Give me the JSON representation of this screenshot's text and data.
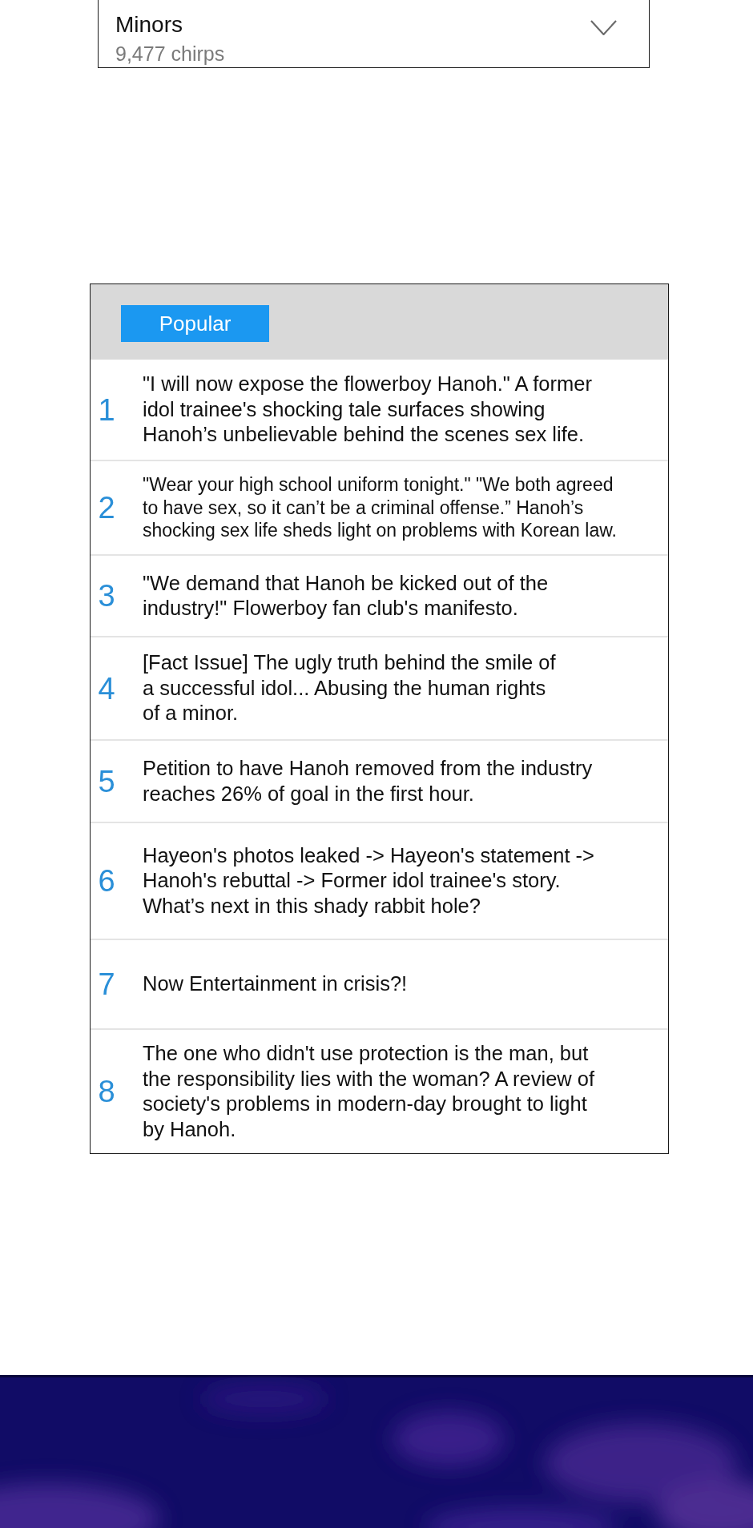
{
  "topic": {
    "title": "Minors",
    "count": "9,477 chirps",
    "expanded": false
  },
  "tabs": [
    {
      "label": "Popular",
      "selected": true
    }
  ],
  "items": [
    {
      "rank": "1",
      "lines": [
        "\"I will now expose the flowerboy Hanoh.\" A former",
        "idol trainee's shocking tale surfaces showing",
        "Hanoh’s unbelievable behind the scenes sex life."
      ]
    },
    {
      "rank": "2",
      "lines": [
        "\"Wear your high school uniform tonight.\" \"We both agreed",
        "to have sex, so it can’t be a criminal offense.” Hanoh’s",
        "shocking sex life sheds light on problems with Korean law."
      ]
    },
    {
      "rank": "3",
      "lines": [
        "\"We demand that Hanoh be kicked out of the",
        "industry!\" Flowerboy fan club's manifesto."
      ]
    },
    {
      "rank": "4",
      "lines": [
        "[Fact Issue] The ugly truth behind the smile of",
        "a successful idol... Abusing the human rights",
        "of a minor."
      ]
    },
    {
      "rank": "5",
      "lines": [
        "Petition to have Hanoh removed from the industry",
        "reaches 26% of goal in the first hour."
      ]
    },
    {
      "rank": "6",
      "lines": [
        "Hayeon's photos leaked -> Hayeon's statement ->",
        "Hanoh's rebuttal -> Former idol trainee's story.",
        "What’s next in this shady rabbit hole?"
      ]
    },
    {
      "rank": "7",
      "lines": [
        "Now Entertainment in crisis?!"
      ]
    },
    {
      "rank": "8",
      "lines": [
        "The one who didn't use protection is the man, but",
        "the responsibility lies with the woman? A review of",
        "society's problems in modern-day brought to light",
        "by Hanoh."
      ]
    }
  ]
}
